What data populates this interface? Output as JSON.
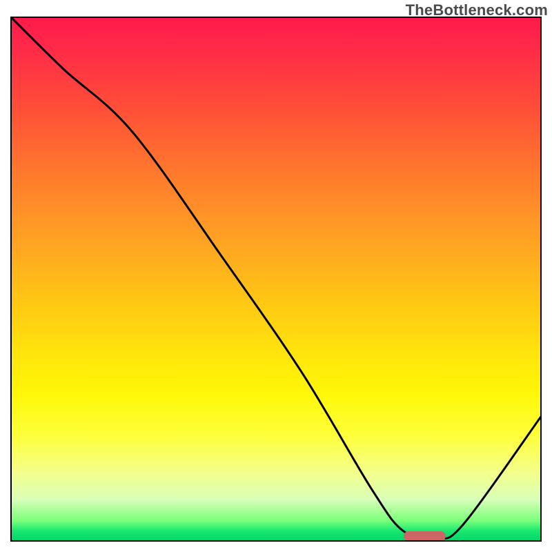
{
  "watermark": "TheBottleneck.com",
  "chart_data": {
    "type": "line",
    "title": "",
    "xlabel": "",
    "ylabel": "",
    "xlim": [
      0,
      100
    ],
    "ylim": [
      0,
      100
    ],
    "grid": false,
    "legend": false,
    "gradient_colors_top_to_bottom": [
      "#ff1a4b",
      "#ff2a48",
      "#ff5037",
      "#ff7a2d",
      "#ffa024",
      "#ffc614",
      "#ffe40d",
      "#fff808",
      "#fdff3c",
      "#f4ff8e",
      "#d9ffb8",
      "#7aff7a",
      "#19e76f",
      "#00d36c"
    ],
    "series": [
      {
        "name": "bottleneck-curve",
        "x": [
          0,
          10,
          23,
          40,
          55,
          68,
          74,
          80,
          85,
          100
        ],
        "y": [
          100,
          90,
          78,
          54,
          32,
          10,
          2,
          1,
          3,
          24
        ]
      }
    ],
    "marker": {
      "name": "optimal-range",
      "x_start": 74,
      "x_end": 82,
      "y": 1,
      "color": "#cc6666"
    }
  }
}
